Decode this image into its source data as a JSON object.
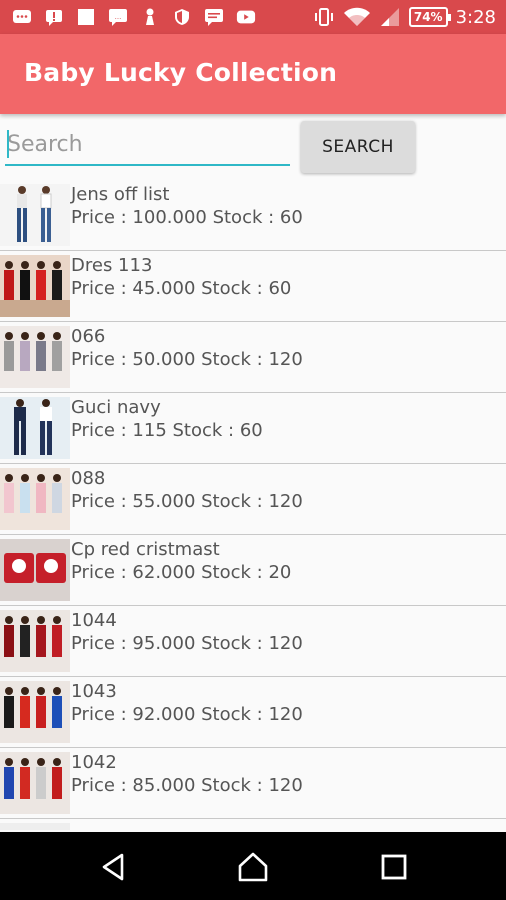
{
  "status_bar": {
    "battery": "74%",
    "time": "3:28",
    "icons": [
      "messages-icon",
      "alert-icon",
      "square-icon",
      "sms-icon",
      "pawn-icon",
      "shield-icon",
      "chat-icon",
      "youtube-icon",
      "vibrate-icon",
      "wifi-icon",
      "signal-icon"
    ]
  },
  "app_bar": {
    "title": "Baby Lucky Collection",
    "color": "#f26769"
  },
  "search": {
    "placeholder": "Search",
    "value": "",
    "button_label": "SEARCH",
    "underline_color": "#2fb8c7"
  },
  "items": [
    {
      "name": "Jens off list",
      "info": "Price : 100.000 Stock : 60",
      "thumb": "jeans-pair"
    },
    {
      "name": "Dres 113",
      "info": "Price : 45.000 Stock : 60",
      "thumb": "dresses-red-black"
    },
    {
      "name": "066",
      "info": "Price : 50.000 Stock : 120",
      "thumb": "dresses-grey"
    },
    {
      "name": "Guci navy",
      "info": "Price : 115 Stock : 60",
      "thumb": "navy-jeans"
    },
    {
      "name": "088",
      "info": "Price : 55.000 Stock : 120",
      "thumb": "dresses-pastel"
    },
    {
      "name": "Cp red cristmast",
      "info": "Price : 62.000 Stock : 20",
      "thumb": "red-shirts"
    },
    {
      "name": "1044",
      "info": "Price : 95.000 Stock : 120",
      "thumb": "dresses-dark-red"
    },
    {
      "name": "1043",
      "info": "Price : 92.000 Stock : 120",
      "thumb": "dresses-red-blue"
    },
    {
      "name": "1042",
      "info": "Price : 85.000 Stock : 120",
      "thumb": "dresses-blue-red"
    },
    {
      "name": "",
      "info": "",
      "thumb": ""
    }
  ],
  "nav": {
    "icons": [
      "back-icon",
      "home-icon",
      "recents-icon"
    ]
  }
}
